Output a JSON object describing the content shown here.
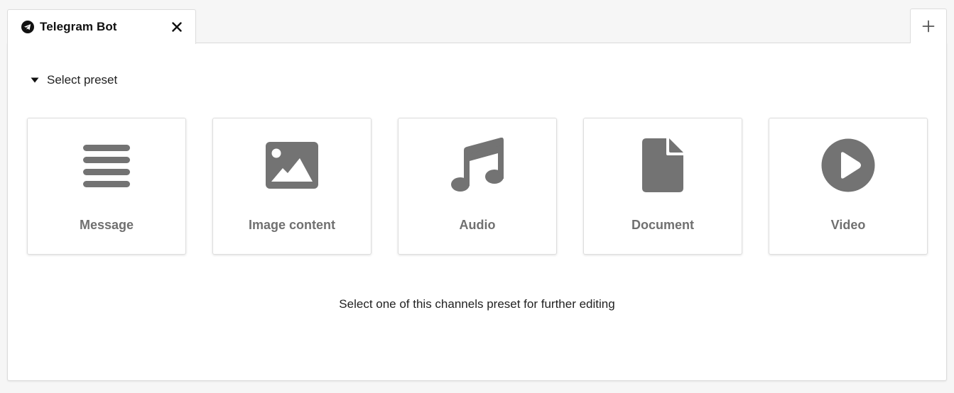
{
  "tab": {
    "label": "Telegram Bot",
    "icon": "telegram-icon",
    "close_icon": "close-icon"
  },
  "add_tab": {
    "icon": "plus-icon"
  },
  "preset_section": {
    "toggle_label": "Select preset",
    "toggle_icon": "caret-down-icon"
  },
  "presets": [
    {
      "label": "Message",
      "icon": "lines-icon"
    },
    {
      "label": "Image content",
      "icon": "image-icon"
    },
    {
      "label": "Audio",
      "icon": "music-note-icon"
    },
    {
      "label": "Document",
      "icon": "document-icon"
    },
    {
      "label": "Video",
      "icon": "play-circle-icon"
    }
  ],
  "hint_text": "Select one of this channels preset for further editing",
  "colors": {
    "icon_gray": "#737373",
    "label_gray": "#707070",
    "border": "#dcdcdc",
    "background": "#f6f6f6"
  }
}
